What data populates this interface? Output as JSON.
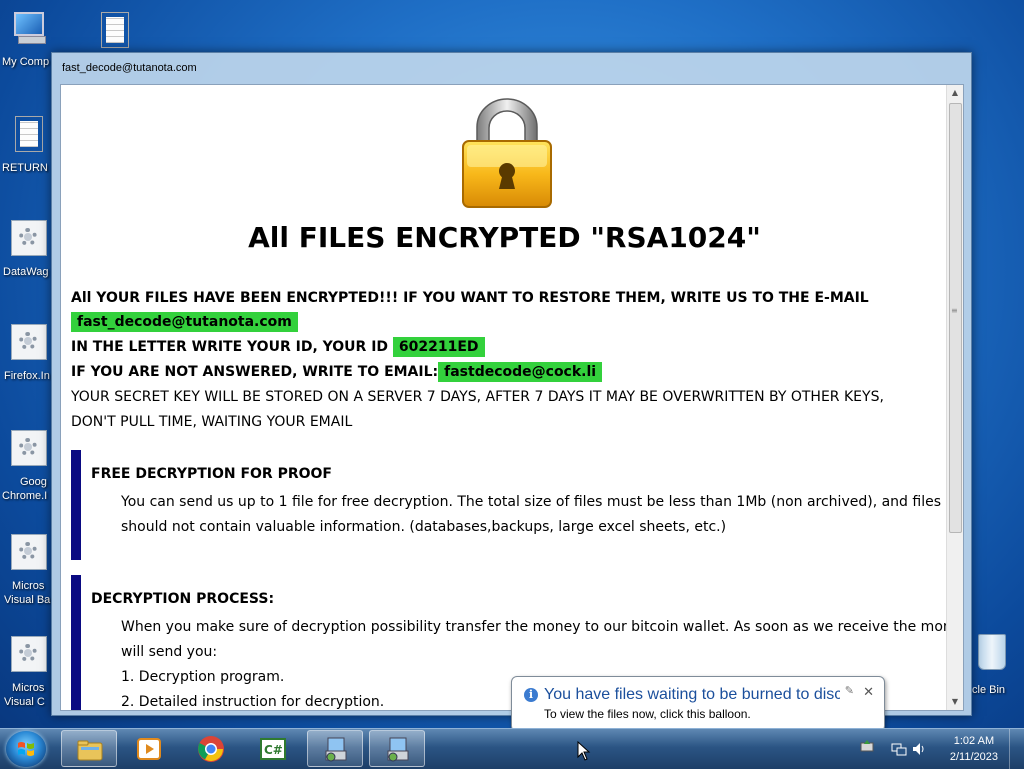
{
  "desktop": {
    "icons": [
      {
        "label": "My Comp",
        "icon": "computer-icon"
      },
      {
        "label": "",
        "icon": "document-icon"
      },
      {
        "label": "RETURN",
        "icon": "document-icon"
      },
      {
        "label": "DataWag",
        "icon": "application-icon"
      },
      {
        "label": "Firefox.In",
        "icon": "application-icon"
      },
      {
        "label": "Goog",
        "label2": "Chrome.I",
        "icon": "application-icon"
      },
      {
        "label": "Micros",
        "label2": "Visual Ba",
        "icon": "application-icon"
      },
      {
        "label": "Micros",
        "label2": "Visual C",
        "icon": "application-icon"
      },
      {
        "label": "cle Bin",
        "icon": "recycle-bin-icon"
      }
    ]
  },
  "window": {
    "title": "fast_decode@tutanota.com",
    "headline": "All FILES ENCRYPTED \"RSA1024\"",
    "line1": "All YOUR FILES HAVE BEEN ENCRYPTED!!! IF YOU WANT TO RESTORE THEM, WRITE US TO THE E-MAIL",
    "email1": "fast_decode@tutanota.com",
    "line2": "IN THE LETTER WRITE YOUR ID, YOUR ID",
    "id": "602211ED",
    "line3": "IF YOU ARE NOT ANSWERED, WRITE TO EMAIL:",
    "email2": "fastdecode@cock.li",
    "line4": "YOUR SECRET KEY WILL BE STORED ON A SERVER 7 DAYS, AFTER 7 DAYS IT MAY BE OVERWRITTEN BY OTHER KEYS,",
    "line5": "DON'T PULL TIME, WAITING YOUR EMAIL",
    "section1": {
      "title": "FREE DECRYPTION FOR PROOF",
      "body1": "You can send us up to 1 file for free decryption. The total size of files must be less than 1Mb (non archived), and files",
      "body2": "should not contain valuable information. (databases,backups, large excel sheets, etc.)"
    },
    "section2": {
      "title": "DECRYPTION PROCESS:",
      "body1": "When you make sure of decryption possibility transfer the money to our bitcoin wallet. As soon as we receive the money we",
      "body2": "will send you:",
      "item1": "1. Decryption program.",
      "item2": "2. Detailed instruction for decryption."
    }
  },
  "balloon": {
    "title": "You have files waiting to be burned to disc",
    "text": "To view the files now, click this balloon."
  },
  "taskbar": {
    "time": "1:02 AM",
    "date": "2/11/2023",
    "colors": {
      "highlight": "#33d13c",
      "section_bar": "#0a0a82"
    }
  }
}
